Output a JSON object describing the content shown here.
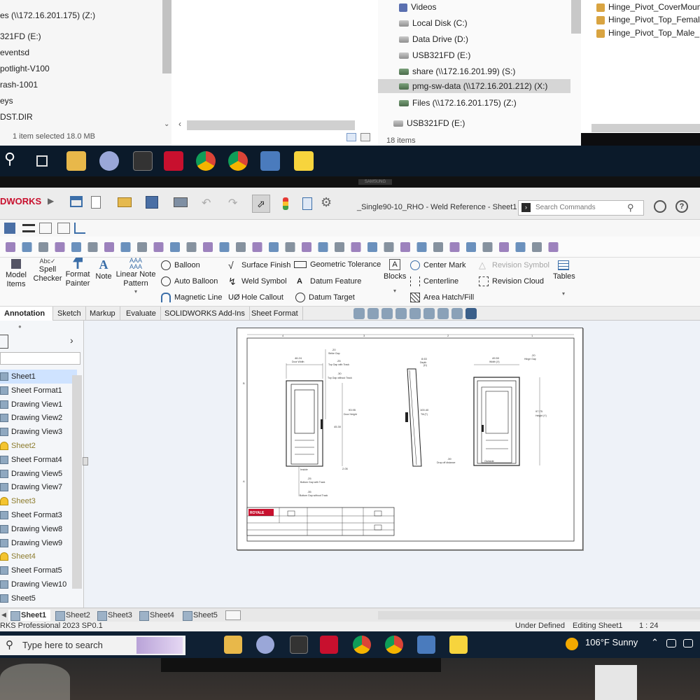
{
  "top_monitor": {
    "left_pane": {
      "rows": [
        "es (\\\\172.16.201.175) (Z:)",
        "321FD (E:)",
        "eventsd",
        "potlight-V100",
        "rash-1001",
        "eys",
        "DST.DIR"
      ],
      "status": "1 item selected  18.0 MB"
    },
    "right_pane": {
      "rows": [
        "Videos",
        "Local Disk (C:)",
        "Data Drive (D:)",
        "USB321FD (E:)",
        "share (\\\\172.16.201.99) (S:)",
        "pmg-sw-data (\\\\172.16.201.212) (X:)",
        "Files (\\\\172.16.201.175) (Z:)",
        "USB321FD (E:)"
      ],
      "status": "18 items"
    },
    "far_pane": {
      "rows": [
        "Hinge_Pivot_CoverMountB",
        "Hinge_Pivot_Top_Female_MC",
        "Hinge_Pivot_Top_Male_MCH"
      ]
    },
    "monitor_brand": "SAMSUNG"
  },
  "solidworks": {
    "logo": "DWORKS",
    "window_title": "_Single90-10_RHO - Weld Reference - Sheet1 *",
    "search_placeholder": "Search Commands",
    "commands": {
      "model_items": "Model Items",
      "spell_checker": "Spell Checker",
      "format_painter": "Format Painter",
      "note": "Note",
      "linear_note_pattern": "Linear Note Pattern",
      "balloon": "Balloon",
      "auto_balloon": "Auto Balloon",
      "magnetic_line": "Magnetic Line",
      "surface_finish": "Surface Finish",
      "weld_symbol": "Weld Symbol",
      "hole_callout": "Hole Callout",
      "geometric_tolerance": "Geometric Tolerance",
      "datum_feature": "Datum Feature",
      "datum_target": "Datum Target",
      "blocks": "Blocks",
      "center_mark": "Center Mark",
      "centerline": "Centerline",
      "area_hatch": "Area Hatch/Fill",
      "revision_symbol": "Revision Symbol",
      "revision_cloud": "Revision Cloud",
      "tables": "Tables"
    },
    "tabs": [
      "Annotation",
      "Sketch",
      "Markup",
      "Evaluate",
      "SOLIDWORKS Add-Ins",
      "Sheet Format"
    ],
    "tree": [
      {
        "label": "Sheet1",
        "type": "sheet",
        "selected": true
      },
      {
        "label": "Sheet Format1",
        "type": "format"
      },
      {
        "label": "Drawing View1",
        "type": "view"
      },
      {
        "label": "Drawing View2",
        "type": "view"
      },
      {
        "label": "Drawing View3",
        "type": "view"
      },
      {
        "label": "Sheet2",
        "type": "warn"
      },
      {
        "label": "Sheet Format4",
        "type": "format"
      },
      {
        "label": "Drawing View5",
        "type": "view"
      },
      {
        "label": "Drawing View7",
        "type": "view"
      },
      {
        "label": "Sheet3",
        "type": "warn"
      },
      {
        "label": "Sheet Format3",
        "type": "format"
      },
      {
        "label": "Drawing View8",
        "type": "view"
      },
      {
        "label": "Drawing View9",
        "type": "view"
      },
      {
        "label": "Sheet4",
        "type": "warn"
      },
      {
        "label": "Sheet Format5",
        "type": "format"
      },
      {
        "label": "Drawing View10",
        "type": "view"
      },
      {
        "label": "Sheet5",
        "type": "sheet"
      }
    ],
    "drawing": {
      "dims": {
        "door_width": "46.24",
        "door_width_label": "Door Width",
        "strike_gap": ".20",
        "strike_gap_label": "Strike Gap",
        "top_gap_track": ".25",
        "top_gap_track_label": "Top Gap with Track",
        "top_gap_no_track": ".30",
        "top_gap_no_track_label": "Top Gap without Track",
        "door_height": "93.95",
        "door_height_label": "Door Height",
        "mid": "45.30",
        "bottom_gap_track": ".25",
        "bottom_gap_track_label": "Bottom Gap with Track",
        "bottom_gap_no_track": ".35",
        "bottom_gap_no_track_label": "Bottom Gap without Track",
        "inside_label": "Inside",
        "r_205": "2.05",
        "depth": "8.63",
        "depth_label": "Depth",
        "depth_sub": "(D)",
        "tilt": "100.40",
        "tilt_label": "Tilt (T)",
        "outside_w": "49.50",
        "outside_w_label": "Width (X)",
        "hinge_gap": ".20",
        "hinge_gap_label": "Hinge Gap",
        "outside_h": "97.75",
        "outside_h_label": "Height (Y)",
        "drop_off": ".39",
        "drop_off_label": "Drop off distance",
        "outside_label": "Outside"
      },
      "title_block_brand": "ROYALE",
      "border_letters": [
        "4",
        "3",
        "2",
        "1",
        "B",
        "A"
      ]
    },
    "sheet_tabs": [
      "Sheet1",
      "Sheet2",
      "Sheet3",
      "Sheet4",
      "Sheet5"
    ],
    "status": {
      "product": "RKS Professional 2023 SP0.1",
      "state": "Under Defined",
      "editing": "Editing Sheet1",
      "scale": "1 : 24"
    }
  },
  "taskbar": {
    "search_placeholder": "Type here to search",
    "weather": "106°F  Sunny"
  }
}
